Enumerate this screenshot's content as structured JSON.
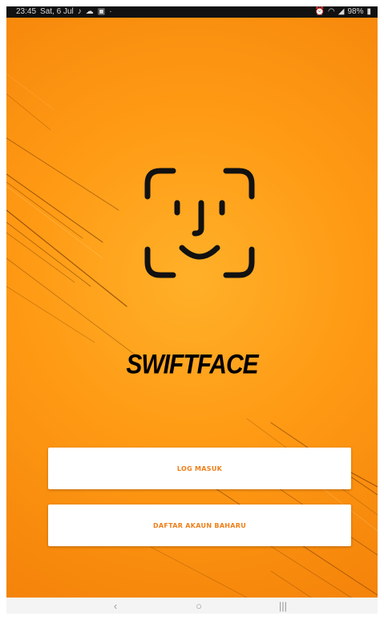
{
  "status_bar": {
    "time": "23:45",
    "date": "Sat, 6 Jul",
    "battery": "98%",
    "notification_icons": [
      "tiktok-icon",
      "cloud-icon",
      "image-icon",
      "dot-icon"
    ],
    "system_icons": [
      "alarm-icon",
      "wifi-icon",
      "signal-icon",
      "battery-icon"
    ]
  },
  "app": {
    "brand_name": "SWIFTFACE",
    "logo_icon": "face-id-icon",
    "login_button": "LOG MASUK",
    "register_button": "DAFTAR AKAUN BAHARU"
  },
  "navigation_bar": {
    "back_icon": "‹",
    "home_icon": "○",
    "recent_icon": "|||"
  },
  "colors": {
    "background_orange": "#ff9a14",
    "button_text": "#ef7f1a",
    "button_bg": "#ffffff",
    "brand_text": "#000000"
  }
}
